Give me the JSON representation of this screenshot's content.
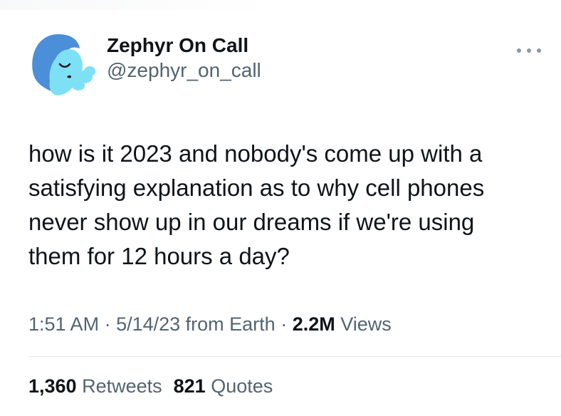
{
  "author": {
    "display_name": "Zephyr On Call",
    "handle": "@zephyr_on_call",
    "avatar_icon": "avatar-cloud-face-icon"
  },
  "tweet": {
    "text": "how is it 2023 and nobody's come up with a\nsatisfying explanation as to why cell phones\nnever show up in our dreams if we're using\nthem for 12 hours a day?"
  },
  "meta": {
    "time": "1:51 AM",
    "sep1": " · ",
    "date": "5/14/23",
    "source": " from Earth",
    "sep2": " · ",
    "views_count": "2.2M",
    "views_label": " Views"
  },
  "stats": {
    "retweets_count": "1,360",
    "retweets_label": " Retweets",
    "quotes_count": "821",
    "quotes_label": " Quotes"
  },
  "more_icon": "more-options-icon",
  "colors": {
    "text_primary": "#0f1419",
    "text_secondary": "#536471",
    "divider": "#e1e6ea",
    "avatar_face": "#7ee0f5",
    "avatar_hair": "#4a8fd8"
  }
}
